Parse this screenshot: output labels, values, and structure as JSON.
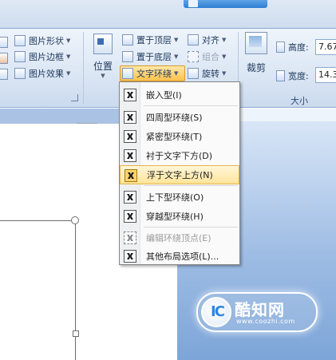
{
  "ribbon": {
    "picture_styles": {
      "shape": "图片形状",
      "border": "图片边框",
      "effects": "图片效果"
    },
    "arrange": {
      "position": "位置",
      "bring_front": "置于顶层",
      "send_back": "置于底层",
      "wrap_text": "文字环绕",
      "align": "对齐",
      "group": "组合",
      "rotate": "旋转"
    },
    "size": {
      "crop": "裁剪",
      "height_label": "高度:",
      "height_value": "7.67",
      "width_label": "宽度:",
      "width_value": "14.3",
      "group_label": "大小"
    }
  },
  "wrap_menu": {
    "items": [
      {
        "label": "嵌入型(I)"
      },
      {
        "label": "四周型环绕(S)"
      },
      {
        "label": "紧密型环绕(T)"
      },
      {
        "label": "衬于文字下方(D)"
      },
      {
        "label": "浮于文字上方(N)"
      },
      {
        "label": "上下型环绕(O)"
      },
      {
        "label": "穿越型环绕(H)"
      },
      {
        "label": "编辑环绕顶点(E)"
      },
      {
        "label": "其他布局选项(L)..."
      }
    ]
  },
  "watermark": {
    "logo": "IC",
    "title": "酷知网",
    "url": "www.coozhi.com"
  }
}
